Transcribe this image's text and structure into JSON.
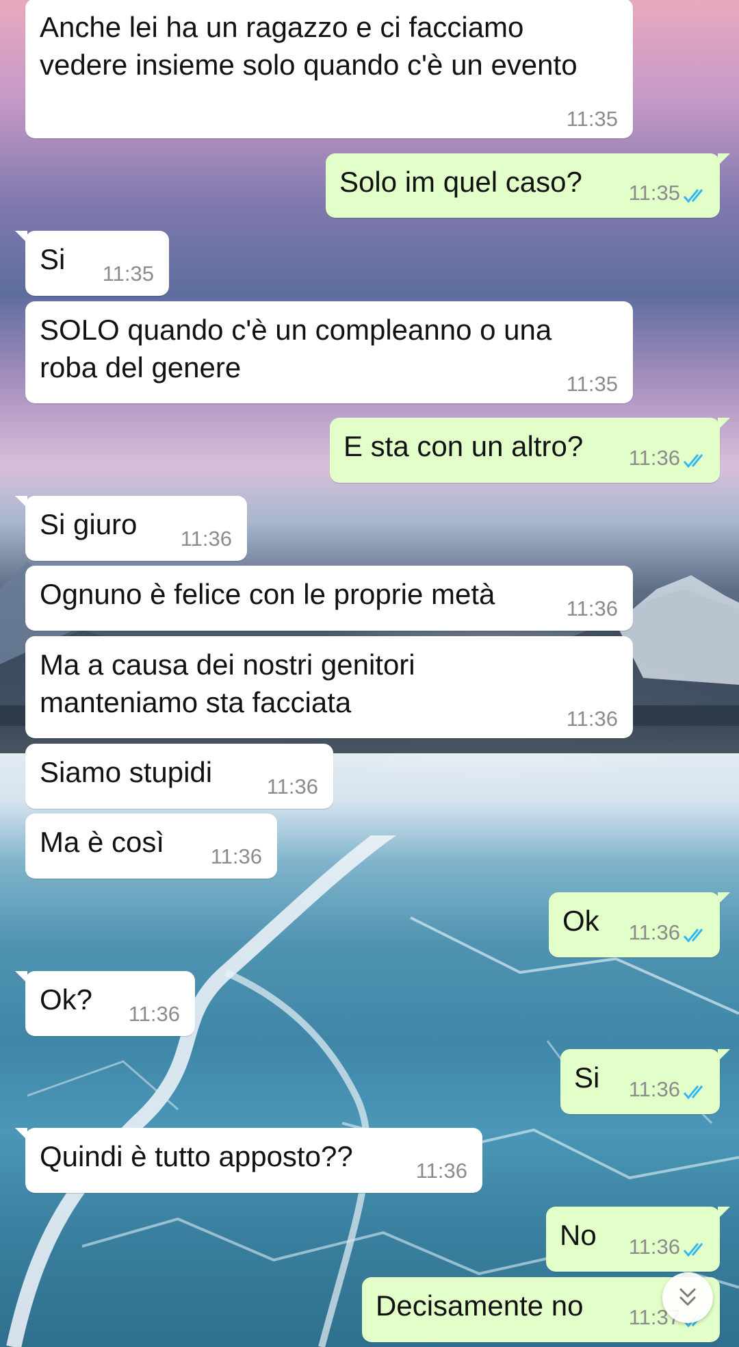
{
  "messages": [
    {
      "dir": "in",
      "text": "Anche lei ha un ragazzo e ci facciamo\nvedere insieme solo quando c'è un evento",
      "time": "11:35"
    },
    {
      "dir": "out",
      "text": "Solo im quel caso?",
      "time": "11:35",
      "status": "read"
    },
    {
      "dir": "in",
      "text": "Si",
      "time": "11:35"
    },
    {
      "dir": "in",
      "text": "SOLO quando c'è un compleanno o una\nroba del genere",
      "time": "11:35"
    },
    {
      "dir": "out",
      "text": "E sta con un altro?",
      "time": "11:36",
      "status": "read"
    },
    {
      "dir": "in",
      "text": "Si giuro",
      "time": "11:36"
    },
    {
      "dir": "in",
      "text": "Ognuno è felice con le proprie metà",
      "time": "11:36"
    },
    {
      "dir": "in",
      "text": "Ma a causa dei nostri genitori\nmanteniamo sta facciata",
      "time": "11:36"
    },
    {
      "dir": "in",
      "text": "Siamo stupidi",
      "time": "11:36"
    },
    {
      "dir": "in",
      "text": "Ma è così",
      "time": "11:36"
    },
    {
      "dir": "out",
      "text": "Ok",
      "time": "11:36",
      "status": "read"
    },
    {
      "dir": "in",
      "text": "Ok?",
      "time": "11:36"
    },
    {
      "dir": "out",
      "text": "Si",
      "time": "11:36",
      "status": "read"
    },
    {
      "dir": "in",
      "text": "Quindi è tutto apposto??",
      "time": "11:36"
    },
    {
      "dir": "out",
      "text": "No",
      "time": "11:36",
      "status": "read"
    },
    {
      "dir": "out",
      "text": "Decisamente no",
      "time": "11:37",
      "status": "read"
    }
  ],
  "colors": {
    "incoming_bubble": "#ffffff",
    "outgoing_bubble": "#e3ffc9",
    "read_ticks": "#34b7f1",
    "timestamp": "#8b8b8b"
  },
  "icons": {
    "read_receipt": "double-check-icon",
    "scroll_down": "double-chevron-down-icon"
  }
}
